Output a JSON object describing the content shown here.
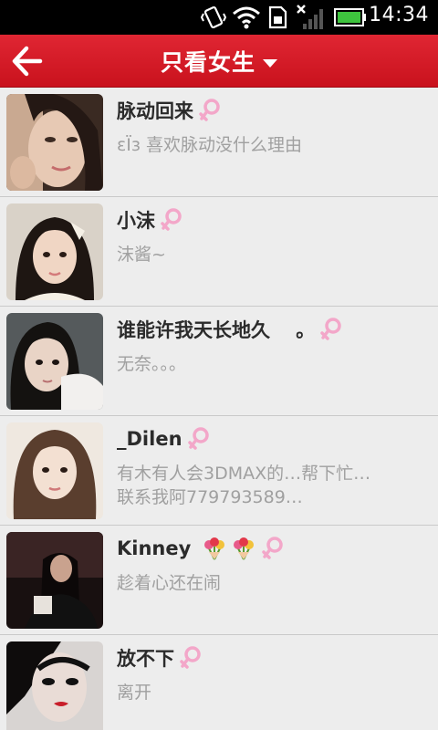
{
  "status_bar": {
    "time": "14:34"
  },
  "header": {
    "title": "只看女生"
  },
  "colors": {
    "accent": "#d51a26",
    "female_symbol": "#f3a7c9"
  },
  "users": [
    {
      "name": "脉动回来",
      "signature": "ɛÏɜ  喜欢脉动没什么理由",
      "badges": []
    },
    {
      "name": "小沫",
      "signature": "沫酱~",
      "badges": []
    },
    {
      "name": "谁能许我天长地久 　。",
      "signature": "无奈。。。",
      "badges": []
    },
    {
      "name": "_Dilen",
      "signature": "有木有人会3DMAX的…帮下忙…联系我阿779793589…",
      "badges": []
    },
    {
      "name": "Kinney",
      "signature": "趁着心还在闹",
      "badges": [
        "flower-bouquet-icon",
        "flower-bouquet-icon"
      ]
    },
    {
      "name": "放不下",
      "signature": "离开",
      "badges": []
    }
  ]
}
